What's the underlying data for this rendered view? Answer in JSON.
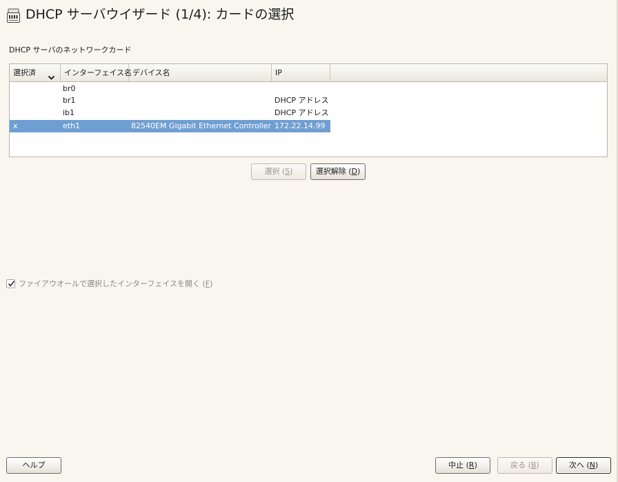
{
  "window": {
    "title": "DHCP サーバウイザード (1/4): カードの選択"
  },
  "frame": {
    "label": "DHCP サーバのネットワークカード"
  },
  "table": {
    "columns": [
      "選択済",
      "インターフェイス名",
      "デバイス名",
      "IP"
    ],
    "rows": [
      {
        "selected": "",
        "interface": "br0",
        "device": "",
        "ip": ""
      },
      {
        "selected": "",
        "interface": "br1",
        "device": "",
        "ip": "DHCP アドレス"
      },
      {
        "selected": "",
        "interface": "ib1",
        "device": "",
        "ip": "DHCP アドレス"
      },
      {
        "selected": "x",
        "interface": "eth1",
        "device": "82540EM Gigabit Ethernet Controller",
        "ip": "172.22.14.99"
      }
    ],
    "highlighted_row": 3,
    "highlight_color": "#6f9ed2"
  },
  "buttons": {
    "select": {
      "label": "選択 (",
      "mnemonic": "S",
      "suffix": ")",
      "enabled": false
    },
    "deselect": {
      "label": "選択解除 (",
      "mnemonic": "D",
      "suffix": ")",
      "enabled": true
    },
    "help": {
      "label": "ヘルプ"
    },
    "abort": {
      "label": "中止 (",
      "mnemonic": "R",
      "suffix": ")",
      "enabled": true
    },
    "back": {
      "label": "戻る (",
      "mnemonic": "B",
      "suffix": ")",
      "enabled": false
    },
    "next": {
      "label": "次へ (",
      "mnemonic": "N",
      "suffix": ")",
      "enabled": true
    }
  },
  "firewall": {
    "label": "ファイアウオールで選択したインターフェイスを開く (",
    "mnemonic": "F",
    "suffix": ")",
    "checked": true,
    "enabled": false
  },
  "icons": {
    "title": "server-icon",
    "sort": "chevron-down-icon",
    "checkbox": "checkmark-icon"
  },
  "colors": {
    "background": "#f9f6ef",
    "selection": "#6f9ed2"
  }
}
